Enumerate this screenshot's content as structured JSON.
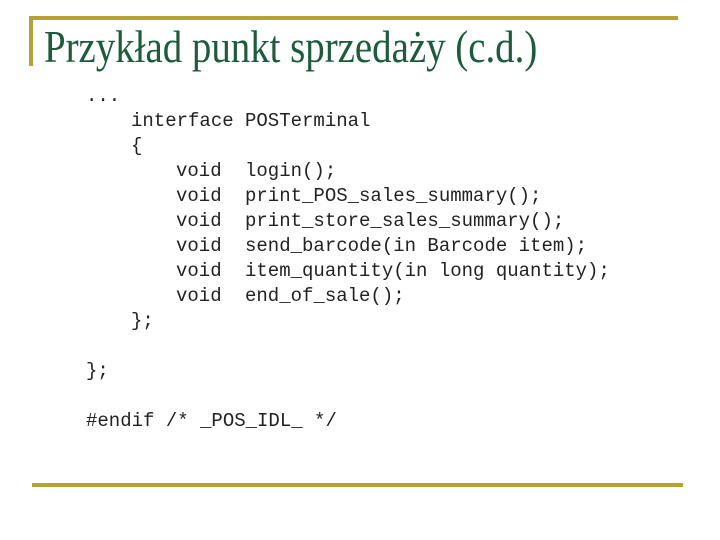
{
  "slide": {
    "title": "Przykład punkt sprzedaży (c.d.)",
    "accent_color": "#b8a032",
    "title_color": "#1b5c3a"
  },
  "code": {
    "ellipsis": "...",
    "interface_keyword": "interface",
    "interface_name": "POSTerminal",
    "open_brace": "{",
    "methods": [
      {
        "return_type": "void",
        "signature": "login();"
      },
      {
        "return_type": "void",
        "signature": "print_POS_sales_summary();"
      },
      {
        "return_type": "void",
        "signature": "print_store_sales_summary();"
      },
      {
        "return_type": "void",
        "signature": "send_barcode(in Barcode item);"
      },
      {
        "return_type": "void",
        "signature": "item_quantity(in long quantity);"
      },
      {
        "return_type": "void",
        "signature": "end_of_sale();"
      }
    ],
    "inner_close": "};",
    "outer_close": "};",
    "endif_line": "#endif /* _POS_IDL_ */"
  }
}
